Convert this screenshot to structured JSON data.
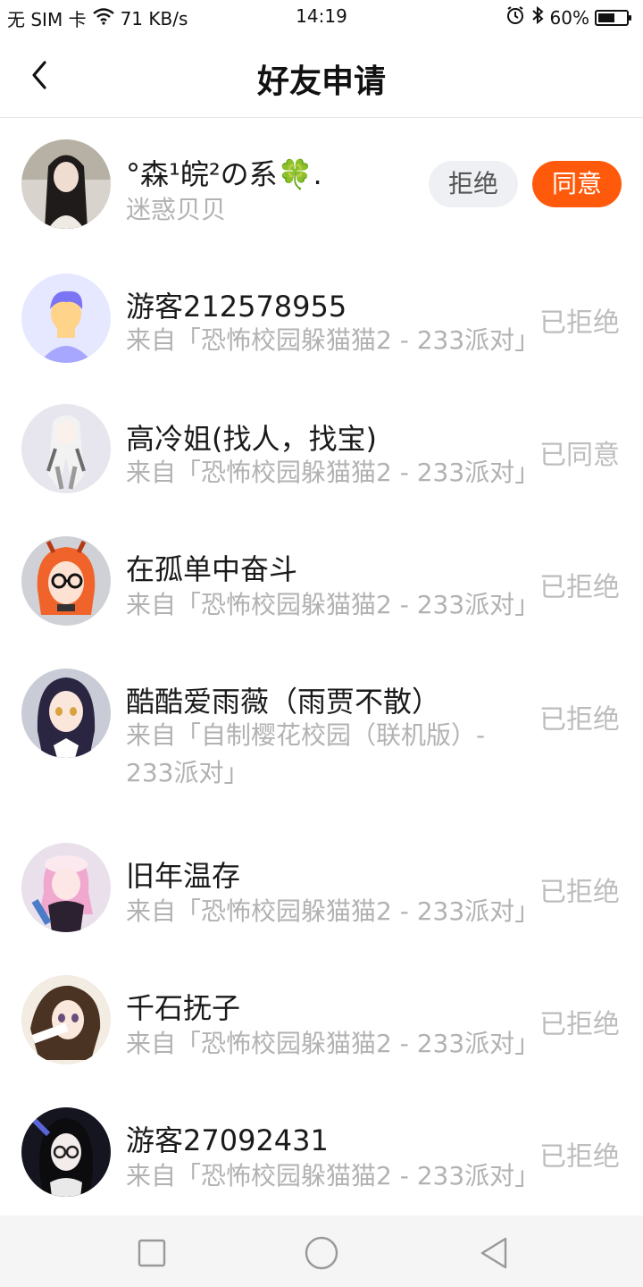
{
  "status_bar": {
    "carrier": "无 SIM 卡",
    "speed": "71 KB/s",
    "time": "14:19",
    "battery": "60%",
    "battery_level": 0.6
  },
  "header": {
    "title": "好友申请"
  },
  "requests": [
    {
      "name": "°森¹皖²の系🍀.",
      "sub": "迷惑贝贝",
      "reject_label": "拒绝",
      "accept_label": "同意"
    },
    {
      "name": "游客212578955",
      "sub": "来自「恐怖校园躲猫猫2 - 233派对」",
      "status": "已拒绝"
    },
    {
      "name": "高冷姐(找人，找宝)",
      "sub": "来自「恐怖校园躲猫猫2 - 233派对」",
      "status": "已同意"
    },
    {
      "name": "在孤单中奋斗",
      "sub": "来自「恐怖校园躲猫猫2 - 233派对」",
      "status": "已拒绝"
    },
    {
      "name": "酷酷爱雨薇（雨贾不散）",
      "sub": "来自「自制樱花校园（联机版）- 233派对」",
      "status": "已拒绝"
    },
    {
      "name": "旧年温存",
      "sub": "来自「恐怖校园躲猫猫2 - 233派对」",
      "status": "已拒绝"
    },
    {
      "name": "千石抚子",
      "sub": "来自「恐怖校园躲猫猫2 - 233派对」",
      "status": "已拒绝"
    },
    {
      "name": "游客27092431",
      "sub": "来自「恐怖校园躲猫猫2 - 233派对」",
      "status": "已拒绝"
    }
  ],
  "colors": {
    "accent": "#ff5a0b",
    "reject_bg": "#eef0f4",
    "muted_text": "#b2b2b2"
  },
  "icons": {
    "back": "chevron-left-icon",
    "nav_recent": "square-icon",
    "nav_home": "circle-icon",
    "nav_back": "triangle-back-icon"
  }
}
